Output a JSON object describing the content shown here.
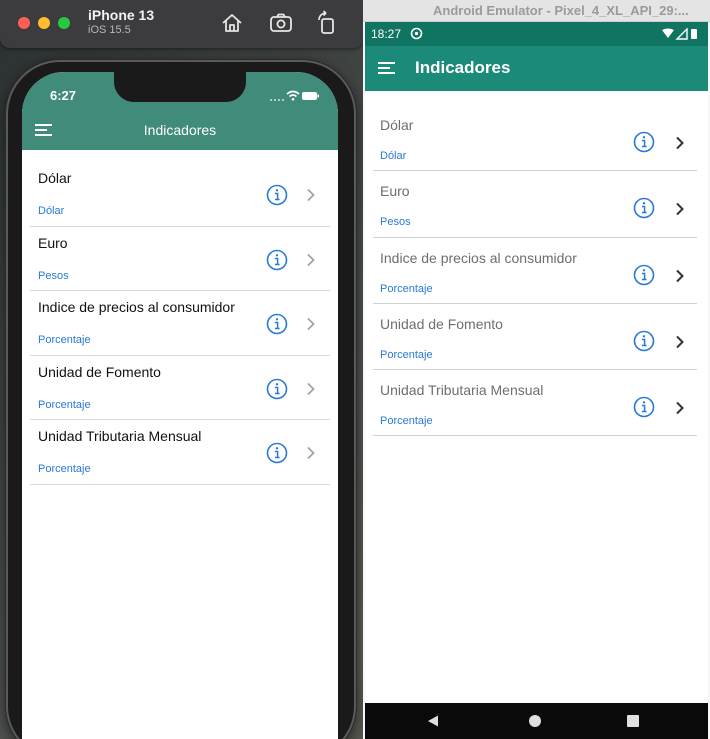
{
  "ios_simulator": {
    "device_name": "iPhone 13",
    "os_version": "iOS 15.5",
    "toolbar_icons": [
      "home-icon",
      "screenshot-icon",
      "rotate-icon"
    ],
    "status_time": "6:27",
    "app_title": "Indicadores",
    "header_color": "#418b7b",
    "items": [
      {
        "title": "Dólar",
        "subtitle": "Dólar"
      },
      {
        "title": "Euro",
        "subtitle": "Pesos"
      },
      {
        "title": "Indice de precios al consumidor",
        "subtitle": "Porcentaje"
      },
      {
        "title": "Unidad de Fomento",
        "subtitle": "Porcentaje"
      },
      {
        "title": "Unidad Tributaria Mensual",
        "subtitle": "Porcentaje"
      }
    ]
  },
  "android_emulator": {
    "window_title": "Android Emulator - Pixel_4_XL_API_29:...",
    "status_time": "18:27",
    "app_title": "Indicadores",
    "appbar_color": "#1c8a79",
    "statusbar_color": "#0f7462",
    "items": [
      {
        "title": "Dólar",
        "subtitle": "Dólar"
      },
      {
        "title": "Euro",
        "subtitle": "Pesos"
      },
      {
        "title": "Indice de precios al consumidor",
        "subtitle": "Porcentaje"
      },
      {
        "title": "Unidad de Fomento",
        "subtitle": "Porcentaje"
      },
      {
        "title": "Unidad Tributaria Mensual",
        "subtitle": "Porcentaje"
      }
    ],
    "nav_buttons": [
      "back-icon",
      "home-icon",
      "recents-icon"
    ]
  },
  "colors": {
    "link_blue": "#2979d8",
    "info_icon": "#2979d8"
  }
}
